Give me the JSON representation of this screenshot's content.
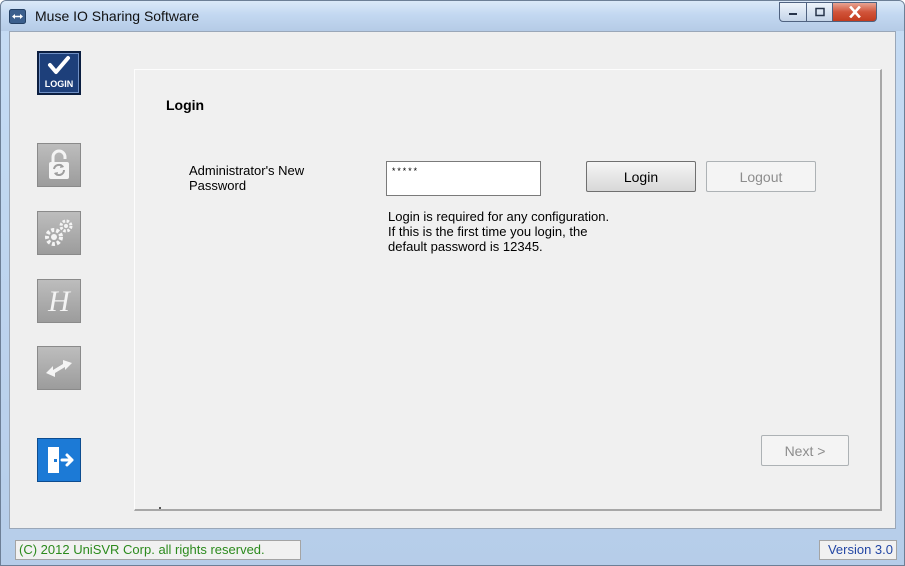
{
  "window": {
    "title": "Muse IO Sharing Software",
    "app_icon": "double-arrow-icon",
    "controls": [
      "minimize-icon",
      "maximize-icon",
      "close-icon"
    ]
  },
  "sidebar": {
    "items": [
      {
        "label": "LOGIN",
        "icon": "check-icon",
        "state": "active"
      },
      {
        "icon": "lock-refresh-icon",
        "state": "disabled"
      },
      {
        "icon": "gears-icon",
        "state": "disabled"
      },
      {
        "icon": "script-h-icon",
        "state": "disabled"
      },
      {
        "icon": "double-arrow-icon",
        "state": "disabled"
      }
    ],
    "exit_icon": "exit-door-icon"
  },
  "panel": {
    "title": "Login",
    "password_label": "Administrator's New Password",
    "password_value": "*****",
    "login_button": "Login",
    "logout_button": "Logout",
    "help_lines": [
      "Login is required for any configuration.",
      "If this is the first time you login, the",
      "default password is 12345."
    ],
    "next_button": "Next >"
  },
  "status": {
    "copyright": "(C) 2012 UniSVR Corp. all rights reserved.",
    "version": "Version 3.0"
  },
  "colors": {
    "copyright_text": "#2b8a1d",
    "version_text": "#2347a5",
    "active_nav": "#1d3f7a",
    "exit_button": "#1c7ad6"
  }
}
